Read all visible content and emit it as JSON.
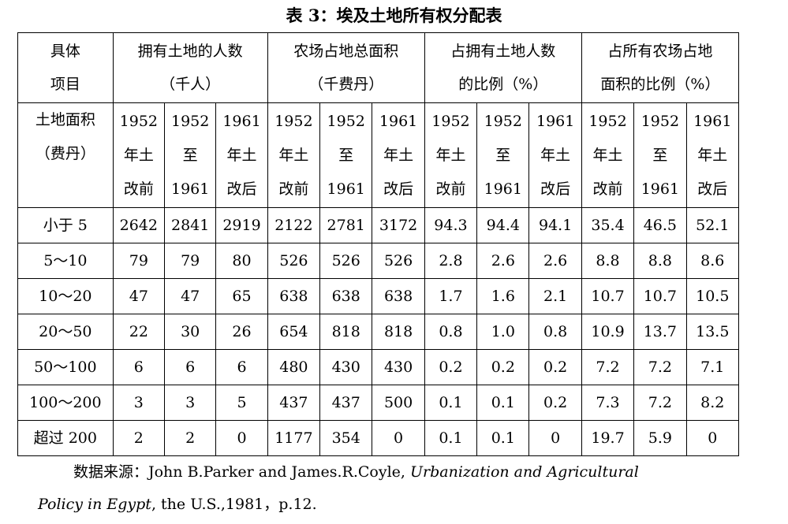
{
  "caption": "表 3：埃及土地所有权分配表",
  "header": {
    "item_line1": "具体",
    "item_line2": "项目",
    "groups": [
      {
        "line1": "拥有土地的人数",
        "line2": "（千人）"
      },
      {
        "line1": "农场占地总面积",
        "line2": "（千费丹）"
      },
      {
        "line1": "占拥有土地人数",
        "line2": "的比例（%）"
      },
      {
        "line1": "占所有农场占地",
        "line2": "面积的比例（%）"
      }
    ],
    "area_line1": "土地面积",
    "area_line2": "（费丹）",
    "periods": [
      {
        "line1": "1952",
        "line2": "年土",
        "line3": "改前"
      },
      {
        "line1": "1952",
        "line2": "至",
        "line3": "1961"
      },
      {
        "line1": "1961",
        "line2": "年土",
        "line3": "改后"
      }
    ]
  },
  "rows": [
    {
      "label": "小于 5",
      "values": [
        "2642",
        "2841",
        "2919",
        "2122",
        "2781",
        "3172",
        "94.3",
        "94.4",
        "94.1",
        "35.4",
        "46.5",
        "52.1"
      ]
    },
    {
      "label": "5～10",
      "values": [
        "79",
        "79",
        "80",
        "526",
        "526",
        "526",
        "2.8",
        "2.6",
        "2.6",
        "8.8",
        "8.8",
        "8.6"
      ]
    },
    {
      "label": "10～20",
      "values": [
        "47",
        "47",
        "65",
        "638",
        "638",
        "638",
        "1.7",
        "1.6",
        "2.1",
        "10.7",
        "10.7",
        "10.5"
      ]
    },
    {
      "label": "20～50",
      "values": [
        "22",
        "30",
        "26",
        "654",
        "818",
        "818",
        "0.8",
        "1.0",
        "0.8",
        "10.9",
        "13.7",
        "13.5"
      ]
    },
    {
      "label": "50～100",
      "values": [
        "6",
        "6",
        "6",
        "480",
        "430",
        "430",
        "0.2",
        "0.2",
        "0.2",
        "7.2",
        "7.2",
        "7.1"
      ]
    },
    {
      "label": "100～200",
      "values": [
        "3",
        "3",
        "5",
        "437",
        "437",
        "500",
        "0.1",
        "0.1",
        "0.2",
        "7.3",
        "7.2",
        "8.2"
      ]
    },
    {
      "label": "超过 200",
      "values": [
        "2",
        "2",
        "0",
        "1177",
        "354",
        "0",
        "0.1",
        "0.1",
        "0",
        "19.7",
        "5.9",
        "0"
      ]
    }
  ],
  "source": {
    "prefix": "数据来源：John B.Parker and James.R.Coyle, ",
    "title_part1": "Urbanization and Agricultural",
    "title_part2": "Policy in Egypt",
    "suffix": ", the U.S.,1981，p.12."
  }
}
